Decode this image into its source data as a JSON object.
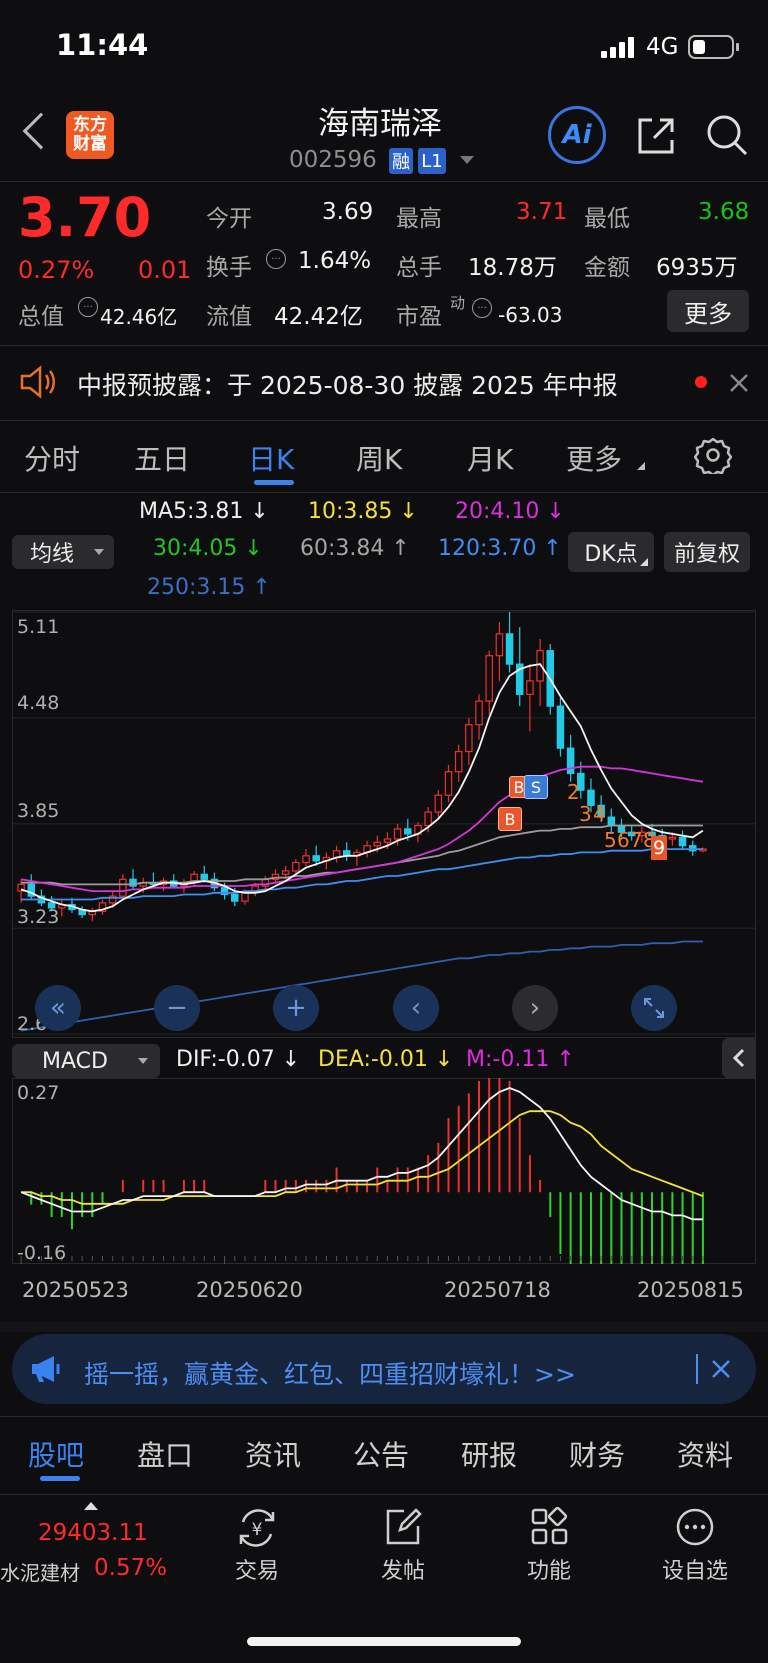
{
  "status_bar": {
    "time": "11:44",
    "network": "4G"
  },
  "header": {
    "logo_line1": "东方",
    "logo_line2": "财富",
    "stock_name": "海南瑞泽",
    "stock_code": "002596",
    "badge_rong": "融",
    "badge_l1": "L1",
    "ai_label": "Ai"
  },
  "quote": {
    "price": "3.70",
    "change_pct": "0.27%",
    "change_abs": "0.01",
    "open_label": "今开",
    "open_value": "3.69",
    "high_label": "最高",
    "high_value": "3.71",
    "low_label": "最低",
    "low_value": "3.68",
    "turnover_label": "换手",
    "turnover_value": "1.64%",
    "volume_label": "总手",
    "volume_value": "18.78万",
    "amount_label": "金额",
    "amount_value": "6935万",
    "total_cap_label": "总值",
    "total_cap_value": "42.46亿",
    "float_cap_label": "流值",
    "float_cap_value": "42.42亿",
    "pe_label": "市盈",
    "pe_sup": "动",
    "pe_value": "-63.03",
    "more_button": "更多"
  },
  "notice": {
    "text": "中报预披露：于 2025-08-30 披露 2025 年中报"
  },
  "period_tabs": [
    "分时",
    "五日",
    "日K",
    "周K",
    "月K",
    "更多"
  ],
  "active_tab_index": 2,
  "ma": {
    "selector": "均线",
    "ma5": "MA5:3.81",
    "ma10": "10:3.85",
    "ma20": "20:4.10",
    "ma30": "30:4.05",
    "ma60": "60:3.84",
    "ma120": "120:3.70",
    "ma250": "250:3.15",
    "dk_button": "DK点",
    "adjust_button": "前复权"
  },
  "chart_data": {
    "type": "candlestick",
    "y_ticks": [
      "5.11",
      "4.48",
      "3.85",
      "3.23",
      "2.60"
    ],
    "ylim": [
      2.6,
      5.11
    ],
    "x_labels": [
      "20250523",
      "20250620",
      "20250718",
      "20250815"
    ],
    "markers": [
      "B",
      "S",
      "B",
      "2",
      "3",
      "4",
      "5",
      "6",
      "7",
      "8",
      "9"
    ],
    "candles": [
      [
        3.45,
        3.52,
        3.38,
        3.49
      ],
      [
        3.49,
        3.55,
        3.4,
        3.42
      ],
      [
        3.42,
        3.46,
        3.36,
        3.38
      ],
      [
        3.38,
        3.42,
        3.33,
        3.35
      ],
      [
        3.35,
        3.4,
        3.3,
        3.37
      ],
      [
        3.37,
        3.41,
        3.32,
        3.34
      ],
      [
        3.34,
        3.36,
        3.29,
        3.31
      ],
      [
        3.31,
        3.35,
        3.27,
        3.33
      ],
      [
        3.33,
        3.4,
        3.31,
        3.38
      ],
      [
        3.38,
        3.45,
        3.35,
        3.42
      ],
      [
        3.42,
        3.55,
        3.4,
        3.52
      ],
      [
        3.52,
        3.58,
        3.46,
        3.48
      ],
      [
        3.48,
        3.53,
        3.44,
        3.5
      ],
      [
        3.5,
        3.56,
        3.47,
        3.49
      ],
      [
        3.49,
        3.53,
        3.45,
        3.51
      ],
      [
        3.51,
        3.55,
        3.47,
        3.48
      ],
      [
        3.48,
        3.52,
        3.44,
        3.5
      ],
      [
        3.5,
        3.57,
        3.48,
        3.55
      ],
      [
        3.55,
        3.6,
        3.5,
        3.52
      ],
      [
        3.52,
        3.56,
        3.45,
        3.47
      ],
      [
        3.47,
        3.5,
        3.4,
        3.43
      ],
      [
        3.43,
        3.47,
        3.36,
        3.39
      ],
      [
        3.39,
        3.46,
        3.37,
        3.44
      ],
      [
        3.44,
        3.5,
        3.42,
        3.48
      ],
      [
        3.48,
        3.54,
        3.46,
        3.52
      ],
      [
        3.52,
        3.58,
        3.5,
        3.55
      ],
      [
        3.55,
        3.6,
        3.52,
        3.57
      ],
      [
        3.57,
        3.64,
        3.55,
        3.62
      ],
      [
        3.62,
        3.7,
        3.6,
        3.66
      ],
      [
        3.66,
        3.72,
        3.6,
        3.63
      ],
      [
        3.63,
        3.68,
        3.58,
        3.65
      ],
      [
        3.65,
        3.72,
        3.62,
        3.69
      ],
      [
        3.69,
        3.74,
        3.63,
        3.66
      ],
      [
        3.66,
        3.7,
        3.6,
        3.68
      ],
      [
        3.68,
        3.75,
        3.65,
        3.72
      ],
      [
        3.72,
        3.78,
        3.68,
        3.74
      ],
      [
        3.74,
        3.8,
        3.7,
        3.76
      ],
      [
        3.76,
        3.85,
        3.72,
        3.82
      ],
      [
        3.82,
        3.88,
        3.75,
        3.79
      ],
      [
        3.79,
        3.86,
        3.74,
        3.84
      ],
      [
        3.84,
        3.95,
        3.8,
        3.92
      ],
      [
        3.92,
        4.05,
        3.88,
        4.02
      ],
      [
        4.02,
        4.2,
        3.98,
        4.16
      ],
      [
        4.16,
        4.32,
        4.1,
        4.28
      ],
      [
        4.28,
        4.48,
        4.2,
        4.44
      ],
      [
        4.44,
        4.62,
        4.35,
        4.58
      ],
      [
        4.58,
        4.88,
        4.5,
        4.85
      ],
      [
        4.85,
        5.05,
        4.7,
        4.98
      ],
      [
        4.98,
        5.11,
        4.75,
        4.8
      ],
      [
        4.8,
        5.02,
        4.55,
        4.62
      ],
      [
        4.62,
        4.8,
        4.4,
        4.7
      ],
      [
        4.7,
        4.95,
        4.55,
        4.88
      ],
      [
        4.88,
        4.92,
        4.5,
        4.55
      ],
      [
        4.55,
        4.6,
        4.25,
        4.3
      ],
      [
        4.3,
        4.38,
        4.1,
        4.15
      ],
      [
        4.15,
        4.22,
        4.0,
        4.05
      ],
      [
        4.05,
        4.12,
        3.92,
        3.96
      ],
      [
        3.96,
        4.02,
        3.86,
        3.89
      ],
      [
        3.89,
        3.94,
        3.8,
        3.84
      ],
      [
        3.84,
        3.88,
        3.77,
        3.8
      ],
      [
        3.8,
        3.84,
        3.75,
        3.78
      ],
      [
        3.78,
        3.83,
        3.74,
        3.8
      ],
      [
        3.8,
        3.85,
        3.76,
        3.78
      ],
      [
        3.78,
        3.82,
        3.73,
        3.76
      ],
      [
        3.76,
        3.8,
        3.72,
        3.77
      ],
      [
        3.77,
        3.81,
        3.7,
        3.72
      ],
      [
        3.72,
        3.75,
        3.66,
        3.69
      ],
      [
        3.69,
        3.71,
        3.68,
        3.7
      ]
    ],
    "ma5": [
      3.46,
      3.44,
      3.41,
      3.39,
      3.37,
      3.36,
      3.34,
      3.33,
      3.34,
      3.36,
      3.4,
      3.43,
      3.46,
      3.48,
      3.5,
      3.5,
      3.49,
      3.5,
      3.51,
      3.5,
      3.48,
      3.45,
      3.44,
      3.44,
      3.45,
      3.48,
      3.51,
      3.55,
      3.59,
      3.61,
      3.63,
      3.65,
      3.66,
      3.66,
      3.68,
      3.7,
      3.72,
      3.75,
      3.77,
      3.79,
      3.83,
      3.88,
      3.95,
      4.04,
      4.16,
      4.3,
      4.48,
      4.63,
      4.73,
      4.77,
      4.79,
      4.8,
      4.71,
      4.61,
      4.52,
      4.43,
      4.29,
      4.17,
      4.06,
      3.98,
      3.9,
      3.85,
      3.82,
      3.8,
      3.79,
      3.78,
      3.77,
      3.81
    ],
    "ma20": [
      3.52,
      3.51,
      3.5,
      3.49,
      3.48,
      3.47,
      3.46,
      3.45,
      3.45,
      3.45,
      3.45,
      3.46,
      3.46,
      3.47,
      3.47,
      3.47,
      3.47,
      3.48,
      3.48,
      3.48,
      3.48,
      3.48,
      3.48,
      3.49,
      3.49,
      3.5,
      3.51,
      3.52,
      3.53,
      3.54,
      3.55,
      3.56,
      3.57,
      3.58,
      3.59,
      3.6,
      3.61,
      3.62,
      3.64,
      3.66,
      3.68,
      3.7,
      3.73,
      3.77,
      3.81,
      3.86,
      3.92,
      3.98,
      4.02,
      4.06,
      4.1,
      4.13,
      4.15,
      4.17,
      4.18,
      4.19,
      4.19,
      4.19,
      4.18,
      4.18,
      4.17,
      4.16,
      4.15,
      4.14,
      4.13,
      4.12,
      4.11,
      4.1
    ],
    "ma60": [
      3.5,
      3.5,
      3.5,
      3.5,
      3.49,
      3.49,
      3.49,
      3.49,
      3.49,
      3.49,
      3.49,
      3.49,
      3.5,
      3.5,
      3.5,
      3.5,
      3.5,
      3.51,
      3.51,
      3.51,
      3.51,
      3.51,
      3.52,
      3.52,
      3.52,
      3.53,
      3.53,
      3.54,
      3.54,
      3.55,
      3.56,
      3.56,
      3.57,
      3.58,
      3.59,
      3.6,
      3.61,
      3.62,
      3.63,
      3.64,
      3.65,
      3.66,
      3.68,
      3.69,
      3.71,
      3.73,
      3.75,
      3.77,
      3.78,
      3.79,
      3.8,
      3.81,
      3.81,
      3.82,
      3.82,
      3.83,
      3.83,
      3.83,
      3.84,
      3.84,
      3.84,
      3.84,
      3.84,
      3.84,
      3.84,
      3.84,
      3.84,
      3.84
    ],
    "ma120": [
      3.4,
      3.4,
      3.4,
      3.4,
      3.4,
      3.4,
      3.4,
      3.4,
      3.41,
      3.41,
      3.41,
      3.41,
      3.42,
      3.42,
      3.42,
      3.42,
      3.43,
      3.43,
      3.43,
      3.44,
      3.44,
      3.44,
      3.45,
      3.45,
      3.46,
      3.46,
      3.47,
      3.47,
      3.48,
      3.49,
      3.49,
      3.5,
      3.51,
      3.51,
      3.52,
      3.53,
      3.54,
      3.54,
      3.55,
      3.56,
      3.57,
      3.58,
      3.58,
      3.59,
      3.6,
      3.61,
      3.62,
      3.63,
      3.64,
      3.65,
      3.65,
      3.66,
      3.66,
      3.67,
      3.67,
      3.68,
      3.68,
      3.68,
      3.69,
      3.69,
      3.69,
      3.69,
      3.7,
      3.7,
      3.7,
      3.7,
      3.7,
      3.7
    ],
    "ma250": [
      2.62,
      2.63,
      2.64,
      2.65,
      2.66,
      2.67,
      2.68,
      2.69,
      2.7,
      2.71,
      2.72,
      2.73,
      2.74,
      2.75,
      2.76,
      2.77,
      2.78,
      2.79,
      2.8,
      2.81,
      2.82,
      2.83,
      2.84,
      2.85,
      2.86,
      2.87,
      2.88,
      2.89,
      2.9,
      2.91,
      2.92,
      2.93,
      2.94,
      2.95,
      2.96,
      2.97,
      2.98,
      2.99,
      3.0,
      3.01,
      3.02,
      3.03,
      3.04,
      3.05,
      3.05,
      3.06,
      3.07,
      3.07,
      3.08,
      3.08,
      3.09,
      3.09,
      3.1,
      3.1,
      3.11,
      3.11,
      3.12,
      3.12,
      3.12,
      3.13,
      3.13,
      3.13,
      3.14,
      3.14,
      3.14,
      3.15,
      3.15,
      3.15
    ]
  },
  "macd": {
    "selector": "MACD",
    "dif": "DIF:-0.07",
    "dea": "DEA:-0.01",
    "m": "M:-0.11",
    "y_top": "0.27",
    "y_bottom": "-0.16",
    "ylim": [
      -0.16,
      0.27
    ],
    "dif_series": [
      0.0,
      -0.01,
      -0.02,
      -0.03,
      -0.04,
      -0.05,
      -0.05,
      -0.05,
      -0.04,
      -0.03,
      -0.02,
      -0.02,
      -0.01,
      -0.01,
      -0.01,
      -0.01,
      0.0,
      0.0,
      0.0,
      -0.01,
      -0.01,
      -0.01,
      -0.01,
      -0.01,
      0.0,
      0.0,
      0.01,
      0.01,
      0.02,
      0.02,
      0.02,
      0.03,
      0.03,
      0.03,
      0.03,
      0.04,
      0.04,
      0.05,
      0.05,
      0.06,
      0.07,
      0.09,
      0.12,
      0.15,
      0.18,
      0.21,
      0.24,
      0.26,
      0.27,
      0.26,
      0.24,
      0.22,
      0.19,
      0.15,
      0.11,
      0.07,
      0.04,
      0.02,
      0.0,
      -0.02,
      -0.03,
      -0.04,
      -0.05,
      -0.05,
      -0.06,
      -0.06,
      -0.07,
      -0.07
    ],
    "dea_series": [
      0.0,
      0.0,
      -0.01,
      -0.01,
      -0.02,
      -0.02,
      -0.03,
      -0.03,
      -0.03,
      -0.03,
      -0.03,
      -0.02,
      -0.02,
      -0.02,
      -0.02,
      -0.01,
      -0.01,
      -0.01,
      -0.01,
      -0.01,
      -0.01,
      -0.01,
      -0.01,
      -0.01,
      -0.01,
      -0.01,
      0.0,
      0.0,
      0.01,
      0.01,
      0.01,
      0.01,
      0.02,
      0.02,
      0.02,
      0.02,
      0.03,
      0.03,
      0.03,
      0.04,
      0.04,
      0.05,
      0.06,
      0.08,
      0.1,
      0.12,
      0.14,
      0.16,
      0.18,
      0.2,
      0.21,
      0.21,
      0.21,
      0.2,
      0.18,
      0.17,
      0.15,
      0.12,
      0.1,
      0.08,
      0.06,
      0.05,
      0.04,
      0.03,
      0.02,
      0.01,
      0.0,
      -0.01
    ]
  },
  "ad_banner": {
    "text": "摇一摇，赢黄金、红包、四重招财壕礼！>>"
  },
  "bottom_tabs": [
    "股吧",
    "盘口",
    "资讯",
    "公告",
    "研报",
    "财务",
    "资料"
  ],
  "active_bottom_tab": 0,
  "dock": {
    "index_value": "29403.11",
    "index_name": "水泥建材",
    "index_change": "0.57%",
    "trade_label": "交易",
    "post_label": "发帖",
    "function_label": "功能",
    "watch_label": "设自选"
  }
}
